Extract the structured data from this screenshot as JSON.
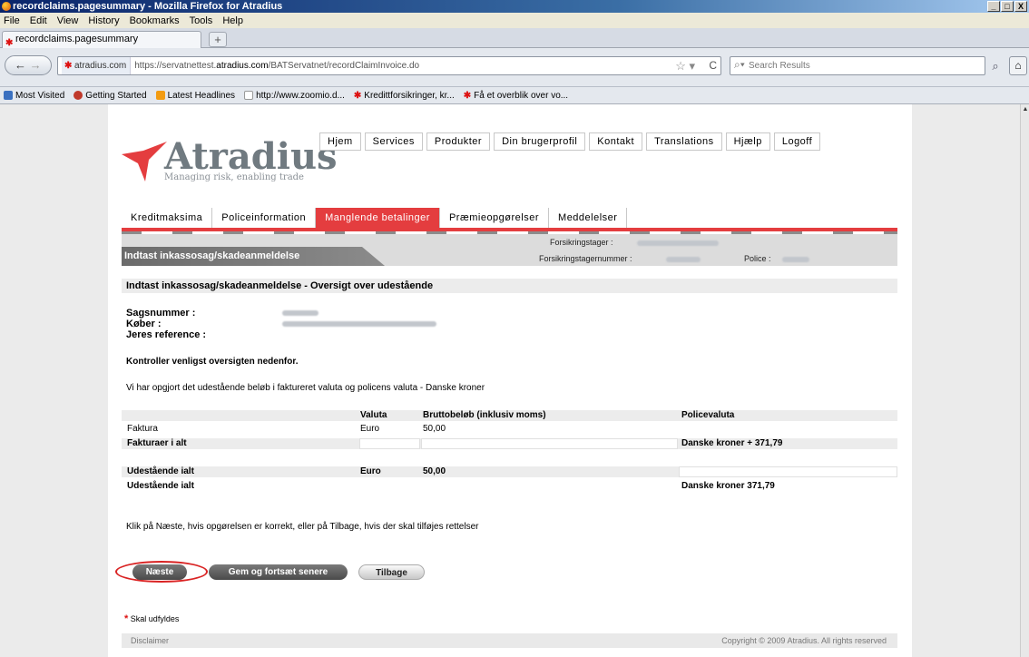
{
  "window": {
    "title": "recordclaims.pagesummary - Mozilla Firefox for Atradius",
    "controls": [
      "_",
      "□",
      "X"
    ]
  },
  "menu": [
    "File",
    "Edit",
    "View",
    "History",
    "Bookmarks",
    "Tools",
    "Help"
  ],
  "tab": {
    "label": "recordclaims.pagesummary",
    "new_tab": "+"
  },
  "nav": {
    "site_badge": "atradius.com",
    "url_prefix": "https://servatnettest.",
    "url_host": "atradius.com",
    "url_path": "/BATServatnet/recordClaimInvoice.do",
    "search_placeholder": "Search Results"
  },
  "bookmarks": [
    "Most Visited",
    "Getting Started",
    "Latest Headlines",
    "http://www.zoomio.d...",
    "Kredittforsikringer, kr...",
    "Få et overblik over vo..."
  ],
  "logo": {
    "name": "Atradius",
    "tagline": "Managing risk, enabling trade",
    "color": "#e43d3f"
  },
  "topnav": [
    "Hjem",
    "Services",
    "Produkter",
    "Din brugerprofil",
    "Kontakt",
    "Translations",
    "Hjælp",
    "Logoff"
  ],
  "subtabs": [
    "Kreditmaksima",
    "Policeinformation",
    "Manglende betalinger",
    "Præmieopgørelser",
    "Meddelelser"
  ],
  "active_subtab": "Manglende betalinger",
  "band": {
    "page_title": "Indtast inkassosag/skadeanmeldelse",
    "forsikringstager_label": "Forsikringstager :",
    "forsikringstagernummer_label": "Forsikringstagernummer :",
    "police_label": "Police :"
  },
  "section_title": "Indtast inkassosag/skadeanmeldelse - Oversigt over udestående",
  "fields": {
    "sagsnummer": "Sagsnummer :",
    "koeber": "Køber :",
    "reference": "Jeres reference :"
  },
  "instructions": {
    "check": "Kontroller venligst oversigten nedenfor.",
    "currency_note": "Vi har opgjort det udestående beløb i faktureret valuta og policens valuta - Danske kroner",
    "next_hint": "Klik på Næste, hvis opgørelsen er korrekt, eller på Tilbage, hvis der skal tilføjes rettelser"
  },
  "table": {
    "headers": {
      "valuta": "Valuta",
      "brutto": "Bruttobeløb (inklusiv moms)",
      "police": "Policevaluta"
    },
    "faktura": {
      "label": "Faktura",
      "valuta": "Euro",
      "amount": "50,00"
    },
    "fakturaer_ialt": {
      "label": "Fakturaer i alt",
      "police": "Danske kroner + 371,79"
    },
    "udestaaende_euro": {
      "label": "Udestående ialt",
      "valuta": "Euro",
      "amount": "50,00"
    },
    "udestaaende_dkk": {
      "label": "Udestående ialt",
      "police": "Danske kroner 371,79"
    }
  },
  "buttons": {
    "next": "Næste",
    "save": "Gem og fortsæt senere",
    "back": "Tilbage"
  },
  "required_note": "Skal udfyldes",
  "footer": {
    "disclaimer": "Disclaimer",
    "copyright": "Copyright © 2009 Atradius. All rights reserved"
  }
}
